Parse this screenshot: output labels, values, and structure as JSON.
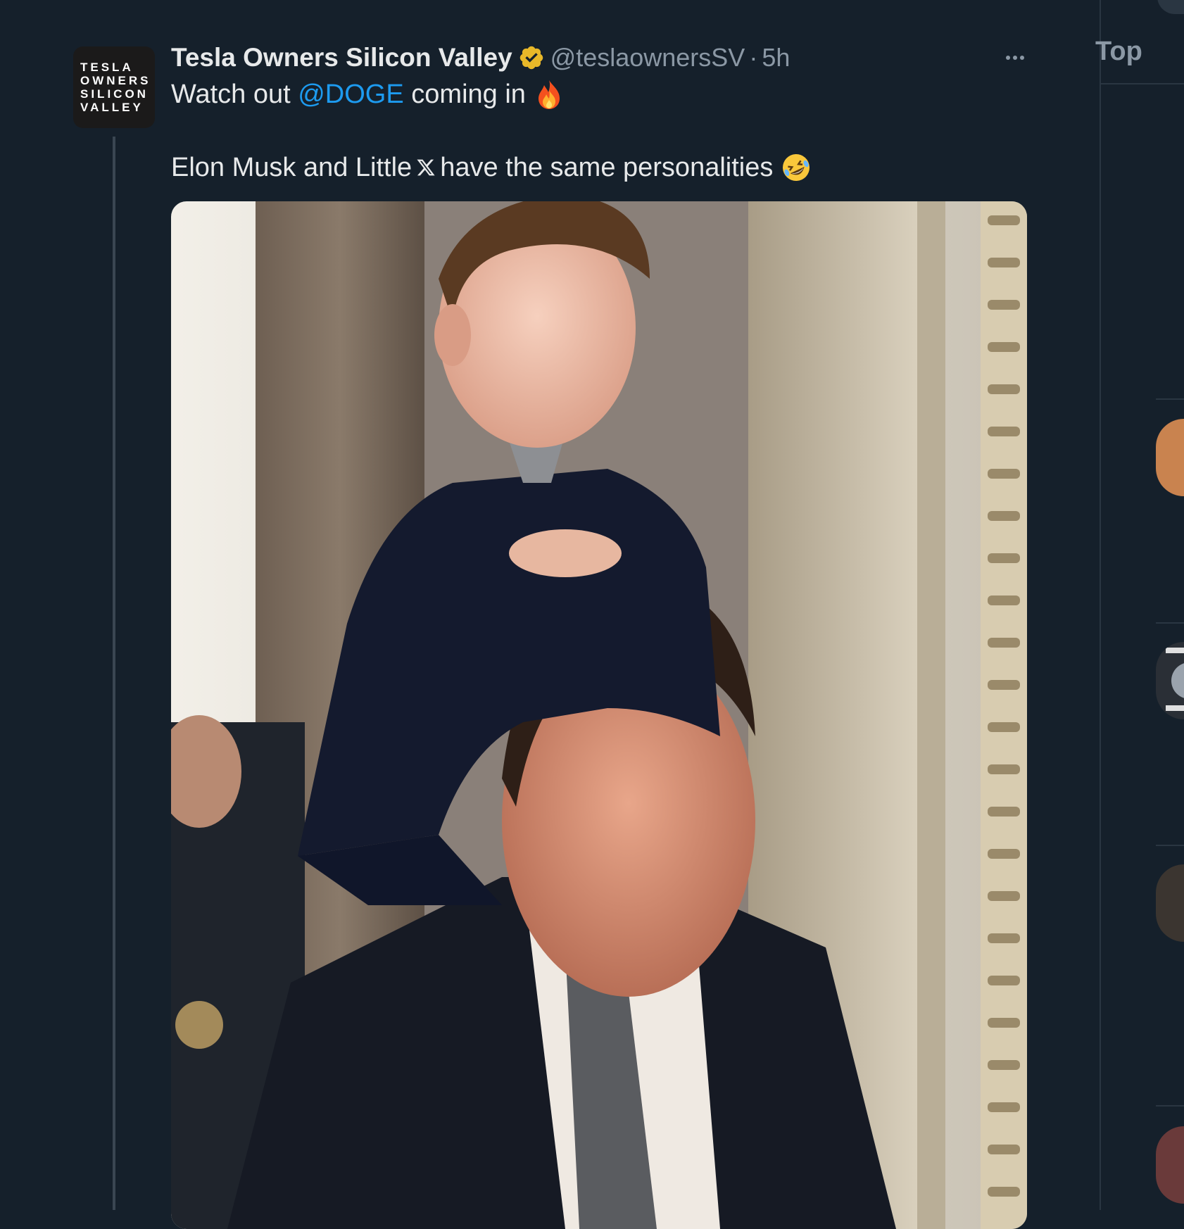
{
  "tweet": {
    "avatar_lines": [
      "TESLA",
      "OWNERS",
      "SILICON",
      "VALLEY"
    ],
    "author_name": "Tesla Owners Silicon Valley",
    "handle": "@teslaownersSV",
    "separator": "·",
    "time": "5h",
    "line1": {
      "before": "Watch out",
      "mention": "@DOGE",
      "after": "coming in",
      "emoji": "fire-emoji"
    },
    "line2": {
      "before": "Elon Musk and Little",
      "logo": "x-logo-icon",
      "after": "have the same personalities",
      "emoji": "rofl-emoji"
    }
  },
  "sidebar": {
    "tab_label": "Top"
  },
  "colors": {
    "background": "#15202b",
    "text": "#e7e9ea",
    "secondary_text": "#8b98a5",
    "link": "#1d9bf0",
    "verified_gold": "#e8b829"
  }
}
